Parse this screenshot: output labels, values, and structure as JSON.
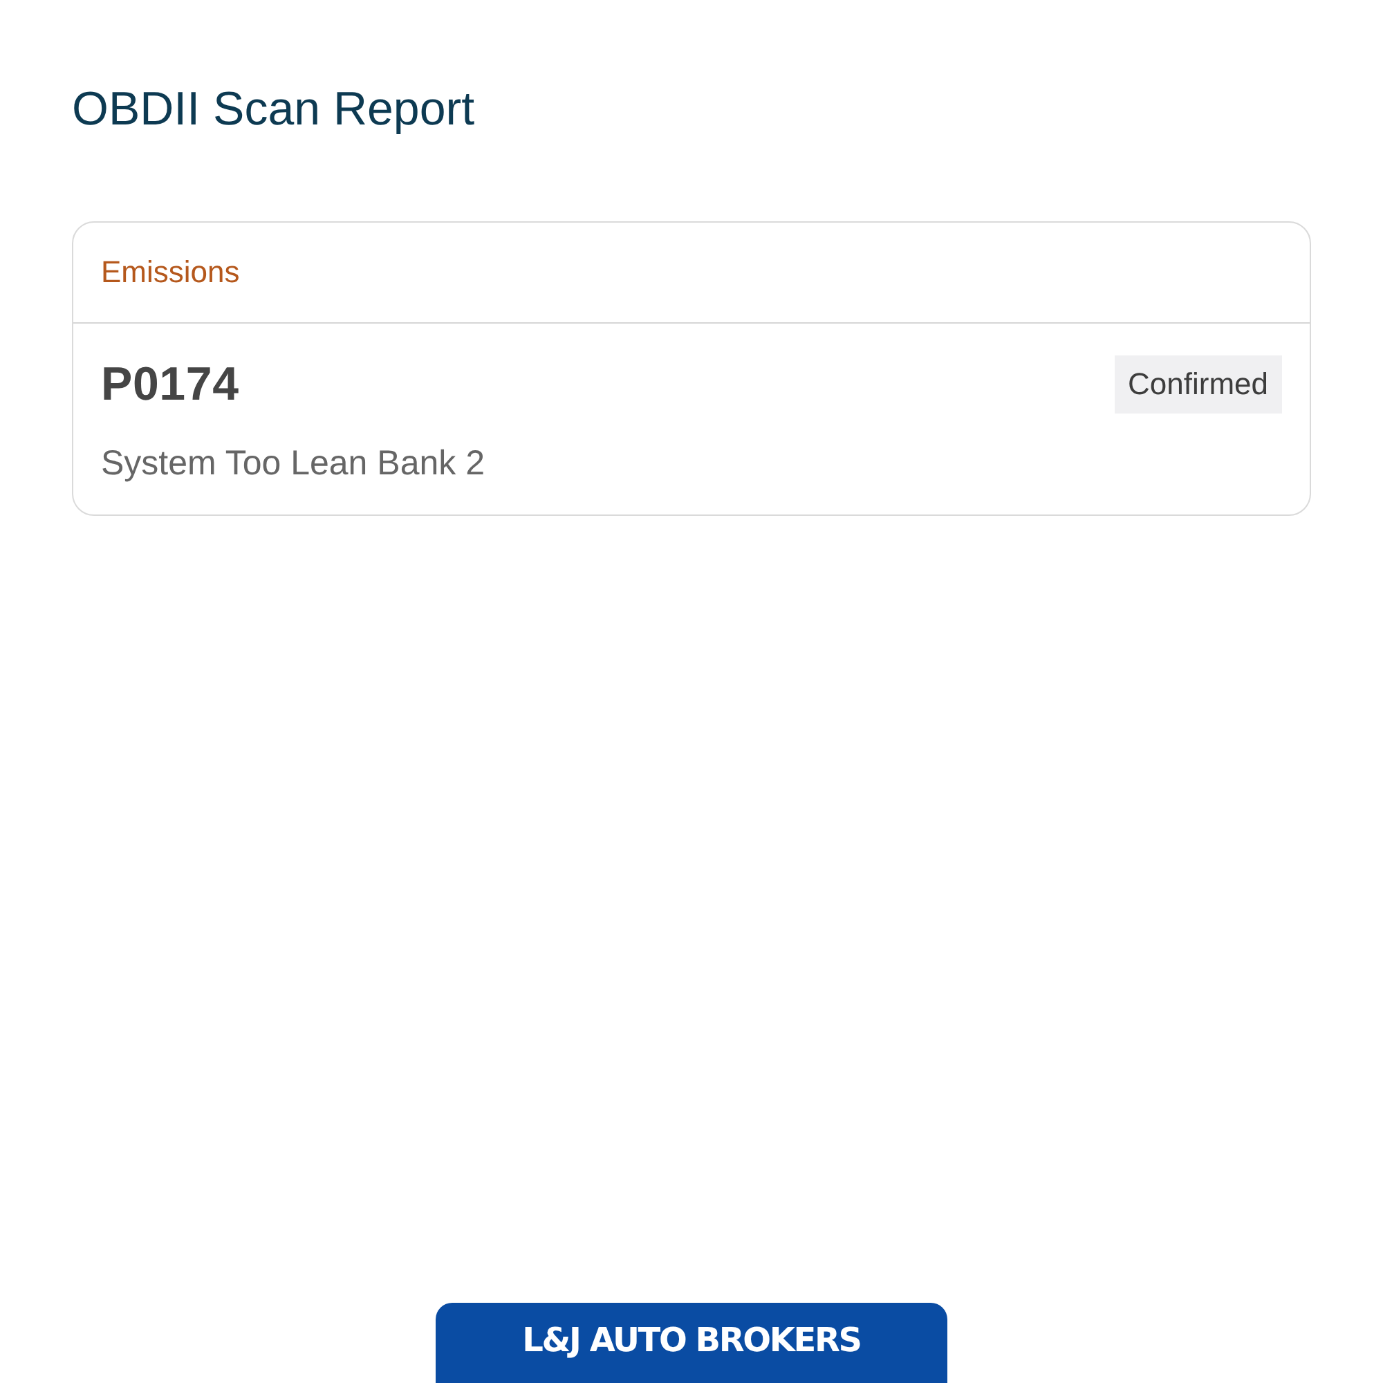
{
  "page": {
    "title": "OBDII Scan Report"
  },
  "sections": [
    {
      "heading": "Emissions",
      "codes": [
        {
          "code": "P0174",
          "status": "Confirmed",
          "description": "System Too Lean Bank 2"
        }
      ]
    }
  ],
  "footer": {
    "logo_text": "L&J AUTO BROKERS"
  }
}
